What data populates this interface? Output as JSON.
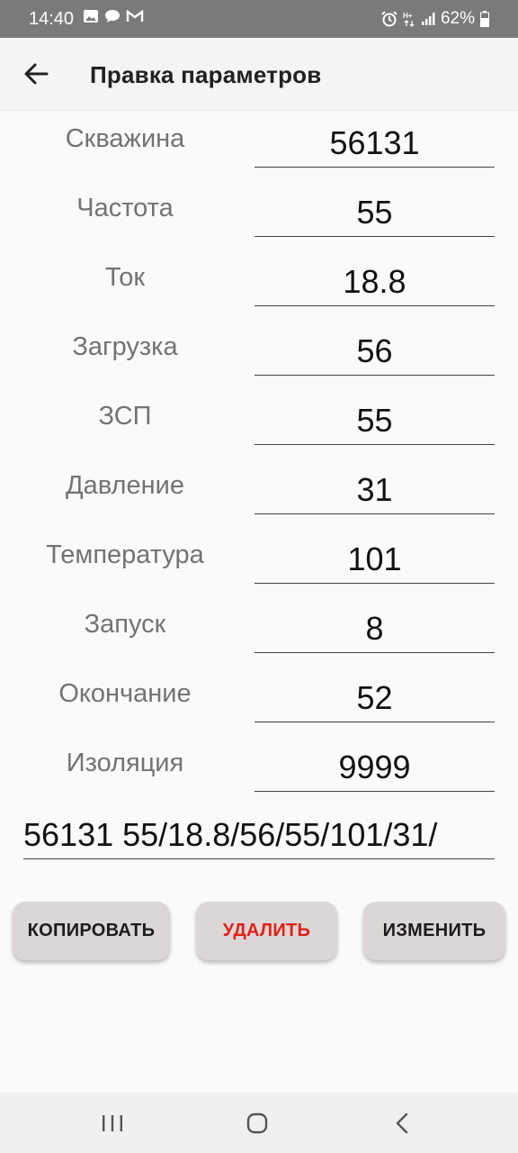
{
  "status_bar": {
    "time": "14:40",
    "battery": "62%",
    "left_icons": [
      "image-icon",
      "chat-icon",
      "gmail-icon"
    ],
    "right_icons": [
      "alarm-icon",
      "data-icon",
      "signal-icon",
      "battery-icon"
    ]
  },
  "app_bar": {
    "title": "Правка параметров",
    "back_icon": "arrow-left-icon"
  },
  "fields": [
    {
      "label": "Скважина",
      "value": "56131"
    },
    {
      "label": "Частота",
      "value": "55"
    },
    {
      "label": "Ток",
      "value": "18.8"
    },
    {
      "label": "Загрузка",
      "value": "56"
    },
    {
      "label": "ЗСП",
      "value": "55"
    },
    {
      "label": "Давление",
      "value": "31"
    },
    {
      "label": "Температура",
      "value": "101"
    },
    {
      "label": "Запуск",
      "value": "8"
    },
    {
      "label": "Окончание",
      "value": "52"
    },
    {
      "label": "Изоляция",
      "value": "9999"
    }
  ],
  "summary": "56131 55/18.8/56/55/101/31/",
  "buttons": {
    "copy": "КОПИРОВАТЬ",
    "delete": "УДАЛИТЬ",
    "edit": "ИЗМЕНИТЬ"
  },
  "colors": {
    "delete_text": "#e0201a",
    "button_bg": "#dcd7d6",
    "status_bar": "#7a7a7a"
  },
  "nav_bar": [
    "recents-icon",
    "home-icon",
    "back-icon"
  ]
}
